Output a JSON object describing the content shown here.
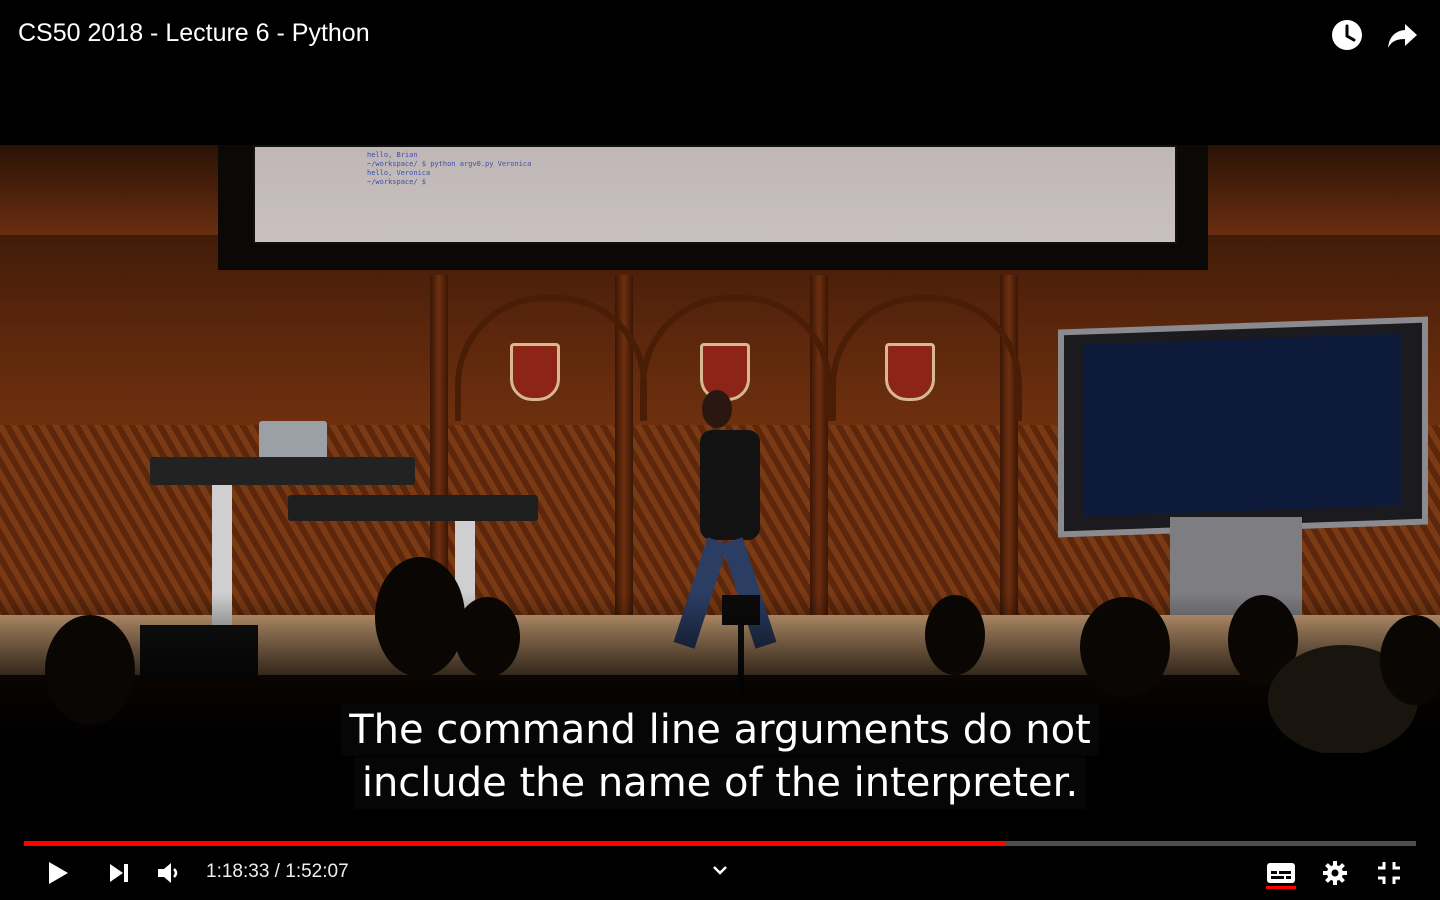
{
  "player": {
    "title": "CS50 2018 - Lecture 6 - Python",
    "top_actions": [
      {
        "name": "watch-later-icon"
      },
      {
        "name": "share-icon"
      }
    ]
  },
  "video": {
    "screen_code": [
      "hello, Brian",
      "~/workspace/ $ python argv0.py Veronica",
      "hello, Veronica",
      "~/workspace/ $"
    ]
  },
  "captions": {
    "lines": [
      "The command line arguments do not",
      "include the name of the interpreter."
    ]
  },
  "controls": {
    "current_time": "1:18:33",
    "separator": " / ",
    "duration": "1:52:07",
    "progress": 0.705,
    "accent_color": "#ff0000"
  }
}
